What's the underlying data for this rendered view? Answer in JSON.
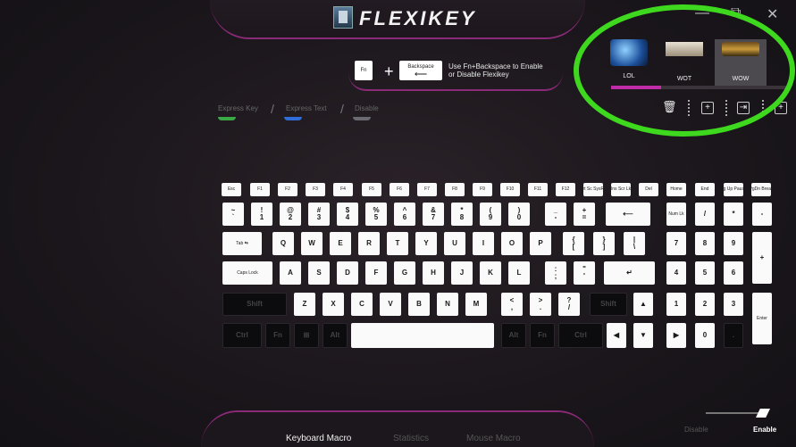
{
  "app": {
    "title": "FLEXIKEY",
    "minimize_glyph": "—",
    "maximize_glyph": "⧉",
    "close_glyph": "✕"
  },
  "hint": {
    "key1": "Fn",
    "key2": "Backspace",
    "key2_arrow": "⟵",
    "plus": "+",
    "line1": "Use Fn+Backspace to Enable",
    "line2": "or Disable Flexikey"
  },
  "profiles": [
    {
      "label": "LOL",
      "active": false
    },
    {
      "label": "WOT",
      "active": false
    },
    {
      "label": "WOW",
      "active": true
    }
  ],
  "profile_progress": 0.28,
  "toolbar": {
    "delete_icon": "🗑",
    "add_icon": "+",
    "export_icon": "⇥",
    "import_icon": "+"
  },
  "modes": [
    {
      "label": "Express Key",
      "color": "#3aa845"
    },
    {
      "label": "Express Text",
      "color": "#2f6ed8"
    },
    {
      "label": "Disable",
      "color": "#6a6a72"
    }
  ],
  "keyboard": {
    "row0": [
      "Esc",
      "F1",
      "F2",
      "F3",
      "F4",
      "F5",
      "F6",
      "F7",
      "F8",
      "F9",
      "F10",
      "F11",
      "F12",
      "Prt Sc SysRq",
      "Ins Scr Lk",
      "Del",
      "Home",
      "End",
      "Pg Up Pause",
      "PgDn Break"
    ],
    "row1": [
      "~\n`",
      "!\n1",
      "@\n2",
      "#\n3",
      "$\n4",
      "%\n5",
      "^\n6",
      "&\n7",
      "*\n8",
      "(\n9",
      ")\n0",
      "_\n-",
      "+\n=",
      "⟵",
      "Num Lk",
      "/",
      "*",
      "-"
    ],
    "row2": [
      "Tab ⇆",
      "Q",
      "W",
      "E",
      "R",
      "T",
      "Y",
      "U",
      "I",
      "O",
      "P",
      "{\n[",
      "}\n]",
      "|\n\\",
      "7",
      "8",
      "9",
      "+"
    ],
    "row3": [
      "Caps Lock",
      "A",
      "S",
      "D",
      "F",
      "G",
      "H",
      "J",
      "K",
      "L",
      ":\n;",
      "\"\n'",
      "↵",
      "4",
      "5",
      "6"
    ],
    "row4": [
      "Shift",
      "Z",
      "X",
      "C",
      "V",
      "B",
      "N",
      "M",
      "<\n,",
      ">\n.",
      "?\n/",
      "Shift",
      "▲",
      "1",
      "2",
      "3",
      "Enter"
    ],
    "row5": [
      "Ctrl",
      "Fn",
      "⊞",
      "Alt",
      "",
      "Alt",
      "Fn",
      "Ctrl",
      "◀",
      "▼",
      "▶",
      "0",
      "."
    ]
  },
  "footer": {
    "tabs": [
      {
        "label": "Keyboard Macro",
        "active": true
      },
      {
        "label": "Statistics",
        "active": false
      },
      {
        "label": "Mouse Macro",
        "active": false
      }
    ],
    "disable_label": "Disable",
    "enable_label": "Enable"
  },
  "colors": {
    "accent": "#c02ba8",
    "ring": "#3ed81f"
  }
}
